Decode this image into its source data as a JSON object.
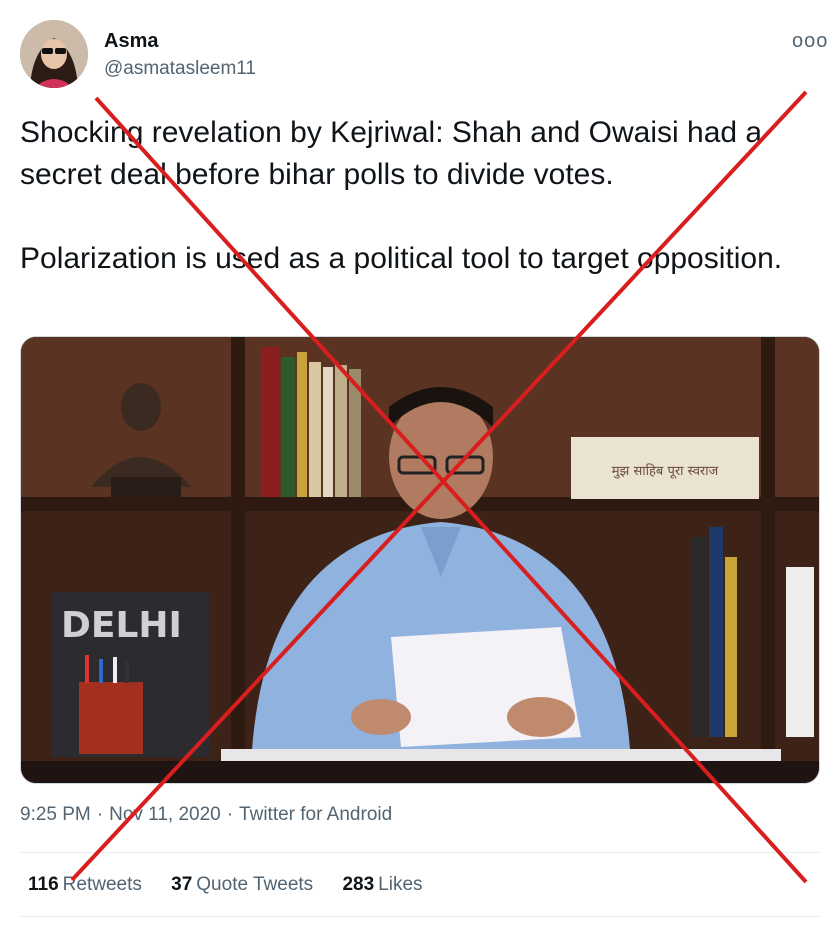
{
  "author": {
    "name": "Asma",
    "handle": "@asmatasleem11"
  },
  "tweet": {
    "paragraphs": [
      "Shocking revelation by Kejriwal: Shah and Owaisi had a secret deal before bihar polls to divide votes.",
      "Polarization is used as a political tool to target opposition."
    ]
  },
  "media": {
    "sign_text": "DELHI",
    "plaque_text": "मुझ साहिब पूरा स्वराज"
  },
  "meta": {
    "time": "9:25 PM",
    "sep": "·",
    "date": "Nov 11, 2020",
    "source": "Twitter for Android"
  },
  "stats": {
    "retweets": {
      "count": "116",
      "label": "Retweets"
    },
    "quotes": {
      "count": "37",
      "label": "Quote Tweets"
    },
    "likes": {
      "count": "283",
      "label": "Likes"
    }
  },
  "more_icon": "ooo",
  "overlay_color": "#d81e1e"
}
